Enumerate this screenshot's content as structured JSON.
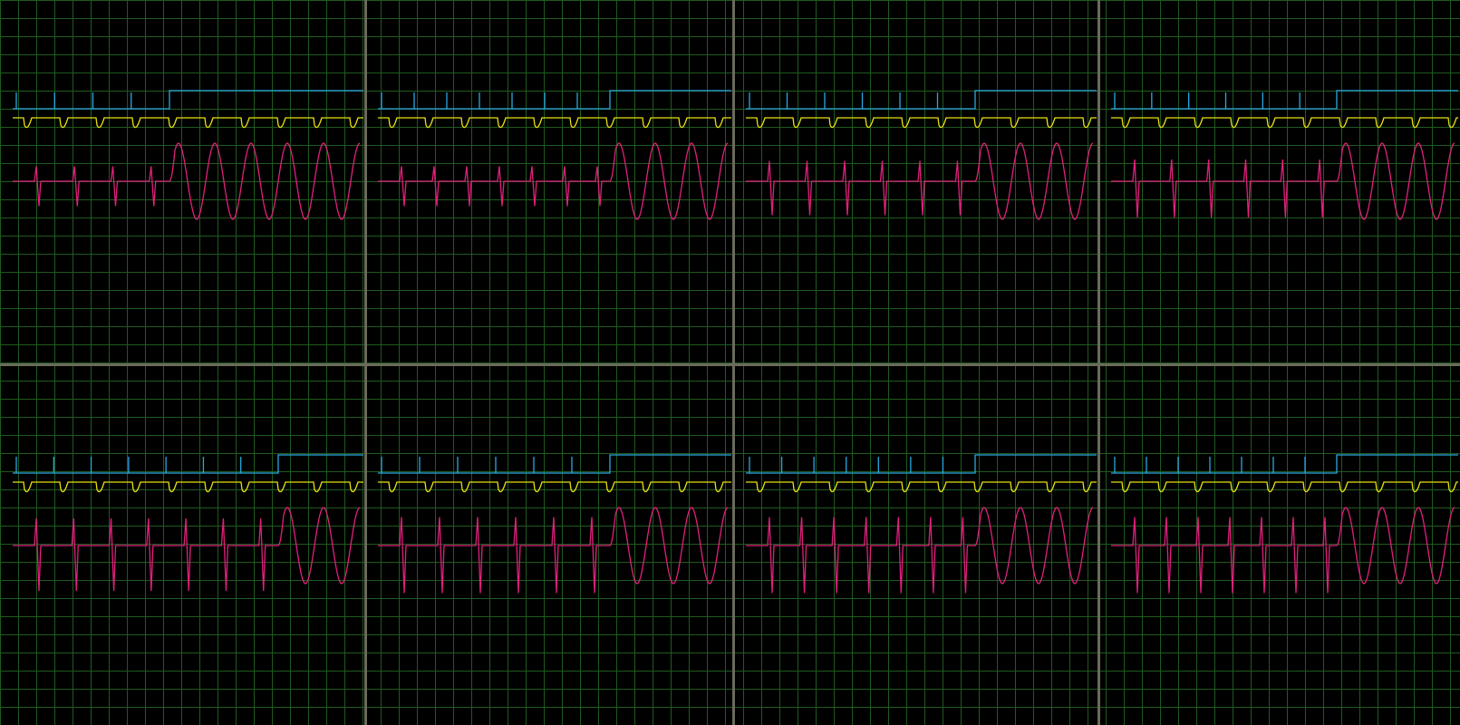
{
  "colors": {
    "background": "#000000",
    "grid": "#1f5a1f",
    "frame": "#6b6b5c",
    "trigger_trace": "#29a8e0",
    "marker_trace": "#e8e010",
    "signal_trace": "#e0207c"
  },
  "panels": [
    {
      "row": 0,
      "col": 0,
      "ticks": 4,
      "burst_cycles": 5,
      "pulse_depth": 0.55
    },
    {
      "row": 0,
      "col": 1,
      "ticks": 7,
      "burst_cycles": 3,
      "pulse_depth": 0.55
    },
    {
      "row": 0,
      "col": 2,
      "ticks": 6,
      "burst_cycles": 3,
      "pulse_depth": 0.75
    },
    {
      "row": 0,
      "col": 3,
      "ticks": 6,
      "burst_cycles": 3,
      "pulse_depth": 0.8
    },
    {
      "row": 1,
      "col": 0,
      "ticks": 7,
      "burst_cycles": 2,
      "pulse_depth": 1.0
    },
    {
      "row": 1,
      "col": 1,
      "ticks": 6,
      "burst_cycles": 3,
      "pulse_depth": 1.05
    },
    {
      "row": 1,
      "col": 2,
      "ticks": 7,
      "burst_cycles": 3,
      "pulse_depth": 1.05
    },
    {
      "row": 1,
      "col": 3,
      "ticks": 7,
      "burst_cycles": 3,
      "pulse_depth": 1.05
    }
  ]
}
